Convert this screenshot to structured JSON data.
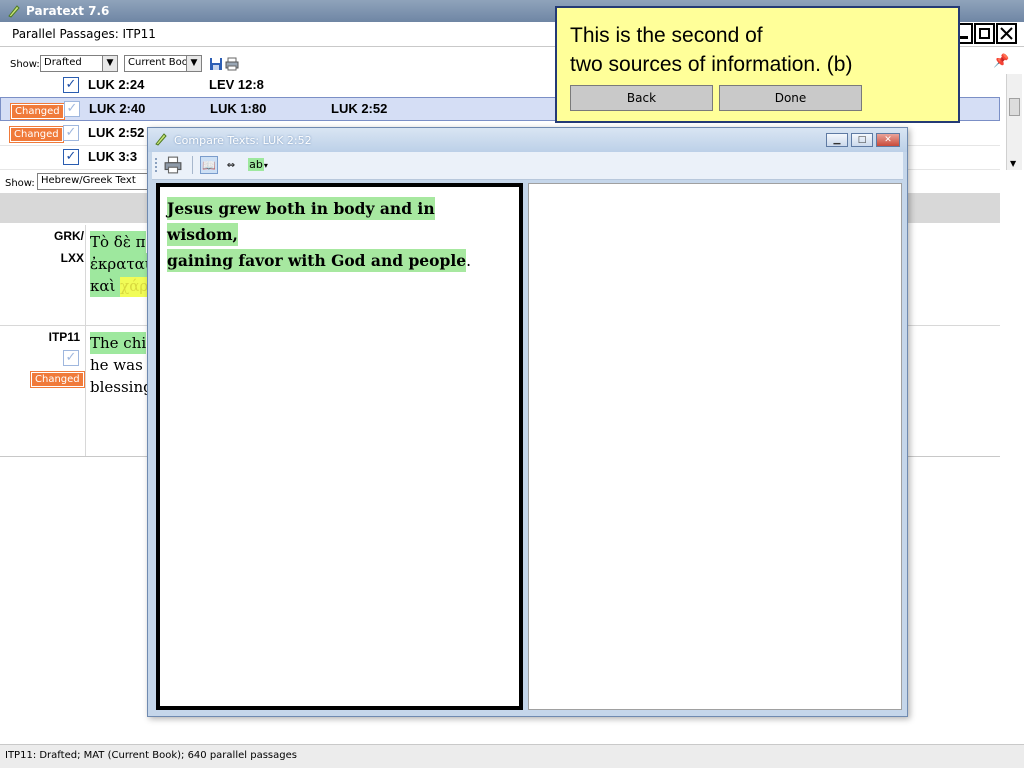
{
  "app": {
    "title": "Paratext 7.6"
  },
  "parallel_passages": {
    "title": "Parallel Passages: ITP11",
    "show_label": "Show:",
    "show_filter": "Drafted",
    "book_filter": "Current Book",
    "rows": [
      {
        "badge": "",
        "checked": true,
        "refs": [
          "LUK 2:24",
          "LEV 12:8",
          ""
        ]
      },
      {
        "badge": "Changed",
        "checked": true,
        "refs": [
          "LUK 2:40",
          "LUK 1:80",
          "LUK 2:52"
        ]
      },
      {
        "badge": "Changed",
        "checked": true,
        "refs": [
          "LUK 2:52",
          "",
          ""
        ]
      },
      {
        "badge": "",
        "checked": true,
        "refs": [
          "LUK 3:3",
          "",
          ""
        ]
      }
    ],
    "show2_label": "Show:",
    "show2_value": "Hebrew/Greek Text",
    "texts": [
      {
        "label_line1": "GRK/",
        "label_line2": "LXX",
        "lines": [
          "Τὸ δὲ π",
          "ἐκραται",
          "καὶ χάρ"
        ]
      },
      {
        "label_line1": "ITP11",
        "badge": "Changed",
        "lines": [
          "The chi",
          "he was f",
          "blessing"
        ]
      }
    ]
  },
  "compare_dialog": {
    "title": "Compare Texts: LUK 2:52",
    "left_text_highlight_1": "Jesus grew both in body and in wisdom,",
    "left_text_highlight_2": "gaining favor with God and people",
    "left_text_tail": ".",
    "toolbar_ab": "ab"
  },
  "tooltip": {
    "line1": "This is the second of",
    "line2": "two sources of information.",
    "suffix": "(b)",
    "back_label": "Back",
    "done_label": "Done"
  },
  "status_bar": {
    "text": "ITP11: Drafted; MAT (Current Book); 640 parallel passages"
  },
  "colors": {
    "changed_badge": "#f07a3a",
    "tooltip_bg": "#ffff99",
    "highlight_green": "#a7e8a0",
    "highlight_yellow": "#ffff4a",
    "selected_row": "#d5def5"
  }
}
